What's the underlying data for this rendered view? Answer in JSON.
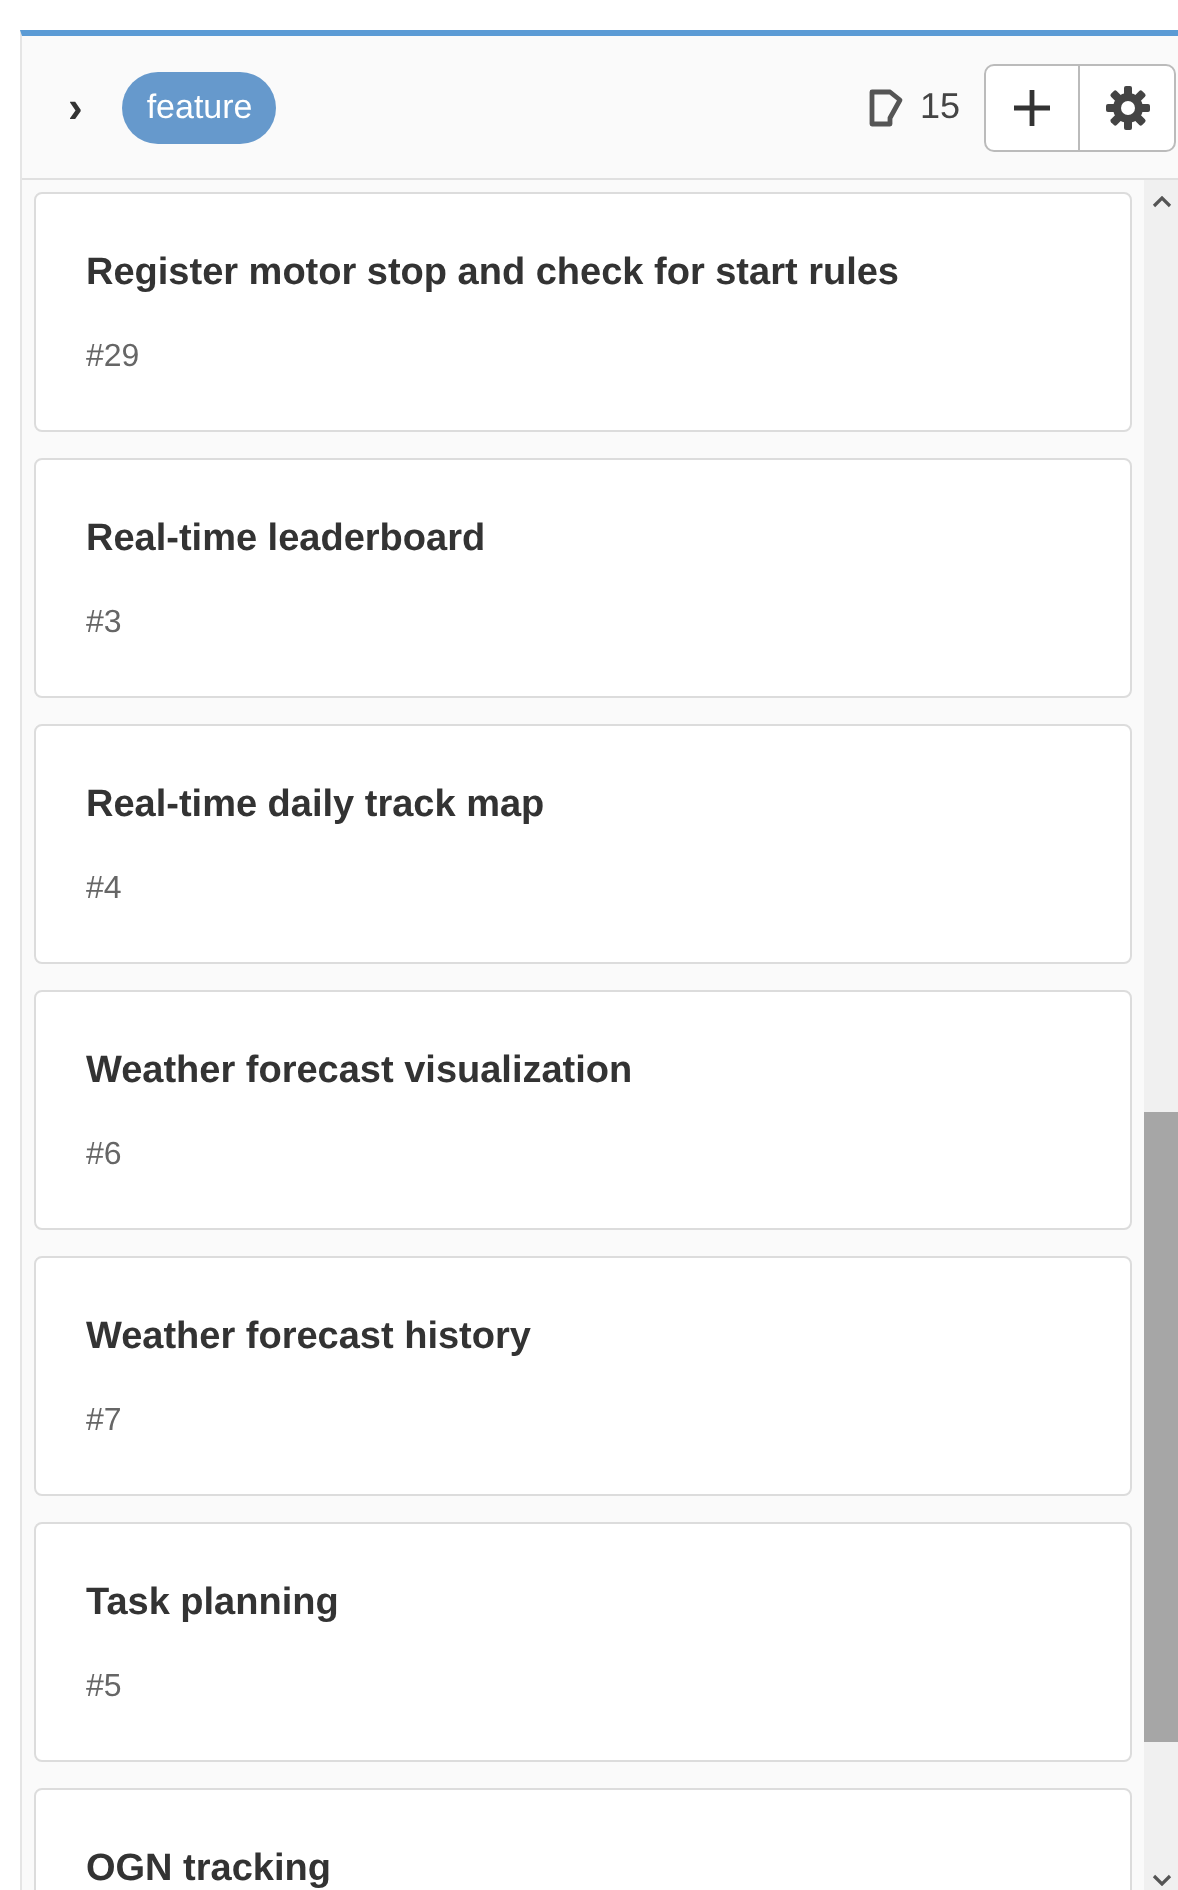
{
  "header": {
    "expand_icon": "›",
    "label": "feature",
    "count": "15"
  },
  "cards": [
    {
      "title": "Register motor stop and check for start rules",
      "number": "#29"
    },
    {
      "title": "Real-time leaderboard",
      "number": "#3"
    },
    {
      "title": "Real-time daily track map",
      "number": "#4"
    },
    {
      "title": "Weather forecast visualization",
      "number": "#6"
    },
    {
      "title": "Weather forecast history",
      "number": "#7"
    },
    {
      "title": "Task planning",
      "number": "#5"
    },
    {
      "title": "OGN tracking"
    }
  ]
}
